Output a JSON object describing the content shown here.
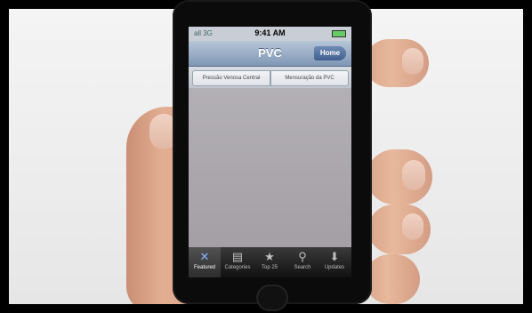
{
  "status": {
    "carrier": "all 3G",
    "time": "9:41 AM"
  },
  "navbar": {
    "title": "PVC",
    "home_label": "Home"
  },
  "segments": [
    "Pressão Venosa Central",
    "Mensuração da PVC"
  ],
  "tabs": [
    {
      "label": "Featured",
      "icon": "featured-icon",
      "active": true
    },
    {
      "label": "Categories",
      "icon": "categories-icon",
      "active": false
    },
    {
      "label": "Top 25",
      "icon": "star-icon",
      "active": false
    },
    {
      "label": "Search",
      "icon": "search-icon",
      "active": false
    },
    {
      "label": "Updates",
      "icon": "download-icon",
      "active": false
    }
  ],
  "colors": {
    "navbar": "#7f97b5",
    "tab_active": "#86b6ff",
    "background": "#e6e6e6"
  }
}
